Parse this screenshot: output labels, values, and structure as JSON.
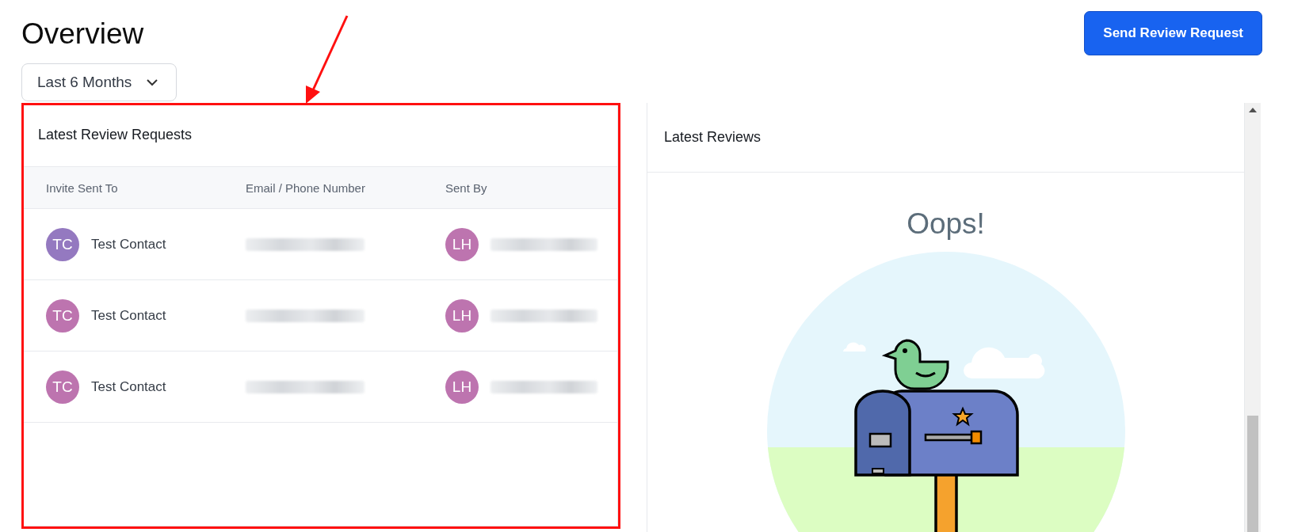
{
  "page": {
    "title": "Overview"
  },
  "period_dropdown": {
    "value": "Last 6 Months"
  },
  "send_button": {
    "label": "Send Review Request"
  },
  "requests_card": {
    "title": "Latest Review Requests",
    "columns": [
      "Invite Sent To",
      "Email / Phone Number",
      "Sent By"
    ],
    "rows": [
      {
        "initials": "TC",
        "color": "#9479c0",
        "name": "Test Contact",
        "sender": {
          "initials": "LH"
        }
      },
      {
        "initials": "TC",
        "color": "#bd74af",
        "name": "Test Contact",
        "sender": {
          "initials": "LH"
        }
      },
      {
        "initials": "TC",
        "color": "#bd74af",
        "name": "Test Contact",
        "sender": {
          "initials": "LH"
        }
      }
    ]
  },
  "reviews_card": {
    "title": "Latest Reviews",
    "empty_title": "Oops!"
  }
}
